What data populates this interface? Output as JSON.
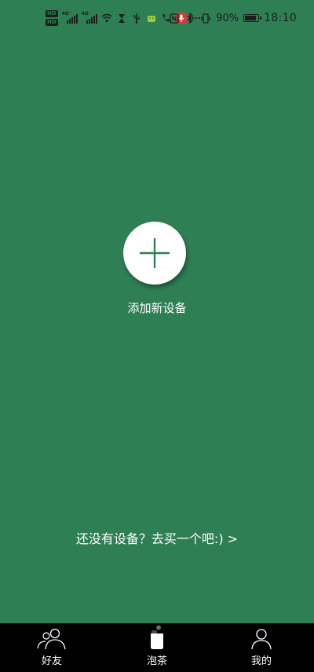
{
  "status_bar": {
    "hd1": "HD",
    "hd2": "HD",
    "signal1_tag": "4G⁺",
    "signal2_tag": "4G",
    "battery_percent": "90%",
    "battery_level": 0.9,
    "time": "18:10"
  },
  "main": {
    "add_device_label": "添加新设备",
    "buy_device_link": "还没有设备？去买一个吧:) >"
  },
  "bottom_nav": {
    "items": [
      {
        "label": "好友",
        "icon": "friends-icon"
      },
      {
        "label": "泡茶",
        "icon": "tea-device-icon"
      },
      {
        "label": "我的",
        "icon": "profile-icon"
      }
    ],
    "active": "泡茶"
  },
  "colors": {
    "background": "#2f7f55",
    "plus": "#2f7f55",
    "nav_background": "#000000",
    "text": "#ffffff"
  }
}
